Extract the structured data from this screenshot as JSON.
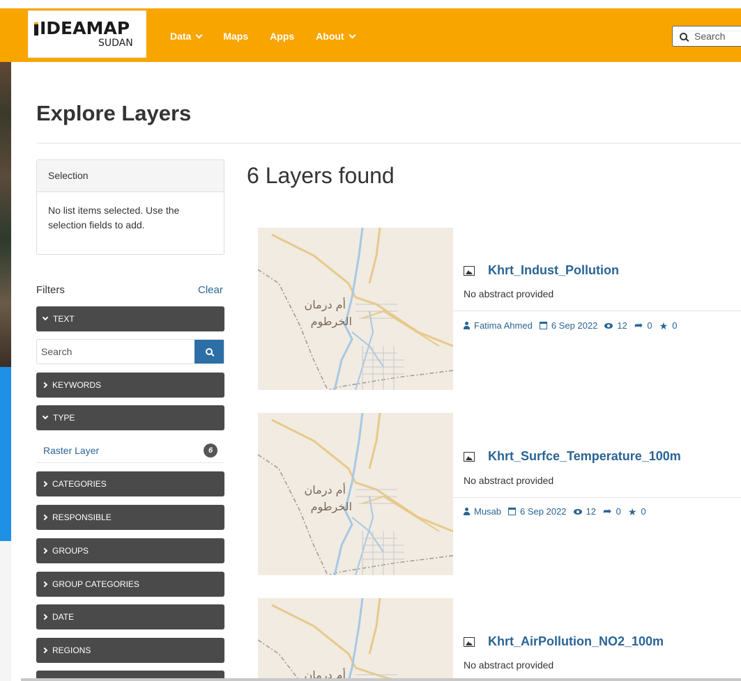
{
  "logo": {
    "line1": "IDEAMAP",
    "line2": "SUDAN"
  },
  "nav": [
    {
      "label": "Data",
      "dropdown": true
    },
    {
      "label": "Maps",
      "dropdown": false
    },
    {
      "label": "Apps",
      "dropdown": false
    },
    {
      "label": "About",
      "dropdown": true
    }
  ],
  "header_search": {
    "placeholder": "Search"
  },
  "page_title": "Explore Layers",
  "selection": {
    "heading": "Selection",
    "body": "No list items selected. Use the selection fields to add."
  },
  "filters": {
    "label": "Filters",
    "clear": "Clear",
    "text_section": "TEXT",
    "text_search_placeholder": "Search",
    "keywords": "KEYWORDS",
    "type_section": "TYPE",
    "type_items": [
      {
        "label": "Raster Layer",
        "count": "6"
      }
    ],
    "sections": [
      "CATEGORIES",
      "RESPONSIBLE",
      "GROUPS",
      "GROUP CATEGORIES",
      "DATE",
      "REGIONS"
    ]
  },
  "results": {
    "heading": "6 Layers found",
    "items": [
      {
        "title": "Khrt_Indust_Pollution",
        "abstract": "No abstract provided",
        "owner": "Fatima Ahmed",
        "date": "6 Sep 2022",
        "views": "12",
        "shares": "0",
        "stars": "0",
        "map_label_1": "أم درمان",
        "map_label_2": "الخرطوم"
      },
      {
        "title": "Khrt_Surfce_Temperature_100m",
        "abstract": "No abstract provided",
        "owner": "Musab",
        "date": "6 Sep 2022",
        "views": "12",
        "shares": "0",
        "stars": "0",
        "map_label_1": "أم درمان",
        "map_label_2": "الخرطوم"
      },
      {
        "title": "Khrt_AirPollution_NO2_100m",
        "abstract": "No abstract provided",
        "map_label_1": "أم درمان"
      }
    ]
  },
  "colors": {
    "header": "#f9a500",
    "link": "#2a6496",
    "filter_bar": "#4a4a4a",
    "search_button": "#2c6fa6"
  }
}
